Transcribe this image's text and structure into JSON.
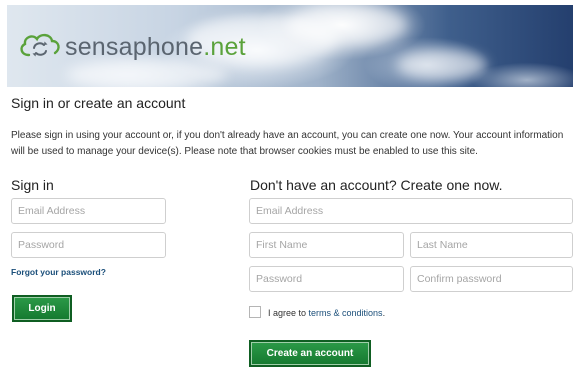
{
  "banner": {
    "logo_word": "sensaphone",
    "logo_tld": ".net",
    "logo_icon": "cloud-arrows-icon"
  },
  "page_title": "Sign in or create an account",
  "intro_text": "Please sign in using your account or, if you don't already have an account, you can create one now. Your account information will be used to manage your device(s). Please note that browser cookies must be enabled to use this site.",
  "signin": {
    "title": "Sign in",
    "email_placeholder": "Email Address",
    "email_value": "",
    "password_placeholder": "Password",
    "password_value": "",
    "forgot_label": "Forgot your password?",
    "login_label": "Login"
  },
  "create": {
    "title": "Don't have an account? Create one now.",
    "email_placeholder": "Email Address",
    "first_name_placeholder": "First Name",
    "last_name_placeholder": "Last Name",
    "password_placeholder": "Password",
    "confirm_placeholder": "Confirm password",
    "agree_prefix": "I agree to ",
    "terms_label": "terms & conditions",
    "agree_suffix": ".",
    "agree_checked": false,
    "create_label": "Create an account"
  },
  "colors": {
    "button_green": "#1f8a3c",
    "link_blue": "#1b4f7a",
    "logo_green": "#5aa23b"
  }
}
